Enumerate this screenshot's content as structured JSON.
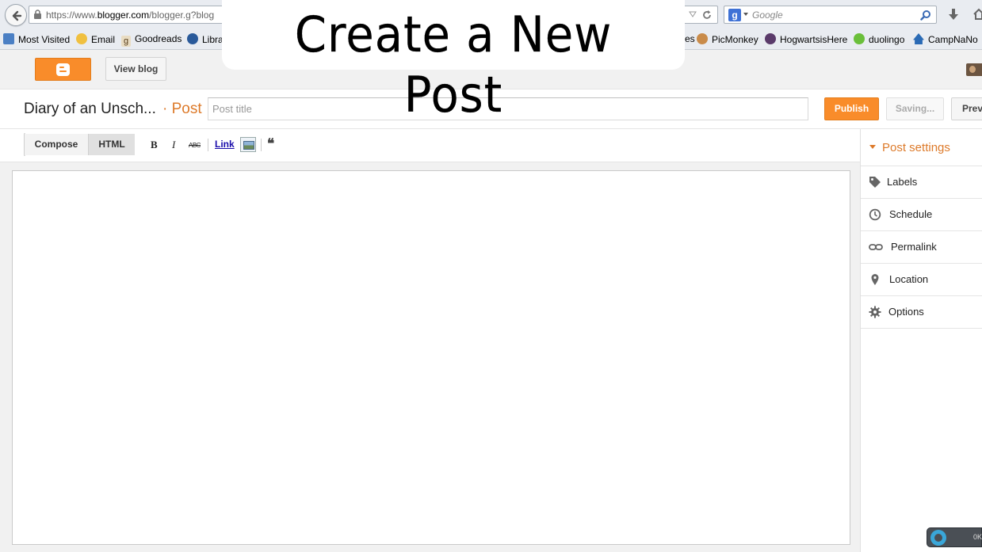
{
  "overlay": {
    "title": "Create a New Post"
  },
  "browser": {
    "url_prefix": "https://www.",
    "url_domain": "blogger.com",
    "url_rest": "/blogger.g?blog",
    "search_placeholder": "Google",
    "search_engine_icon": "g"
  },
  "bookmarks": [
    {
      "label": "Most Visited",
      "icon": "most-visited-icon"
    },
    {
      "label": "Email",
      "icon": "email-icon"
    },
    {
      "label": "Goodreads",
      "icon": "goodreads-icon"
    },
    {
      "label": "Libra",
      "icon": "library-icon"
    },
    {
      "label": "es",
      "icon": ""
    },
    {
      "label": "PicMonkey",
      "icon": "picmonkey-icon"
    },
    {
      "label": "HogwartsisHere",
      "icon": "hogwarts-icon"
    },
    {
      "label": "duolingo",
      "icon": "duolingo-icon"
    },
    {
      "label": "CampNaNo",
      "icon": "campnano-icon"
    }
  ],
  "header": {
    "view_blog": "View blog"
  },
  "post": {
    "blog_name": "Diary of an Unsch...",
    "crumb": "· Post",
    "title_placeholder": "Post title",
    "publish": "Publish",
    "saving": "Saving...",
    "preview": "Prev"
  },
  "toolbar": {
    "compose": "Compose",
    "html": "HTML",
    "bold": "B",
    "italic": "I",
    "strike": "ABC",
    "link": "Link",
    "quote": "❝"
  },
  "sidebar": {
    "title": "Post settings",
    "items": [
      {
        "label": "Labels",
        "icon": "tag-icon"
      },
      {
        "label": "Schedule",
        "icon": "clock-icon"
      },
      {
        "label": "Permalink",
        "icon": "link-icon"
      },
      {
        "label": "Location",
        "icon": "location-pin-icon"
      },
      {
        "label": "Options",
        "icon": "gear-icon"
      }
    ]
  },
  "widget": {
    "text": "0K"
  },
  "colors": {
    "accent": "#f98c2a",
    "accent_text": "#dd7a2a",
    "link": "#1a0dab"
  }
}
